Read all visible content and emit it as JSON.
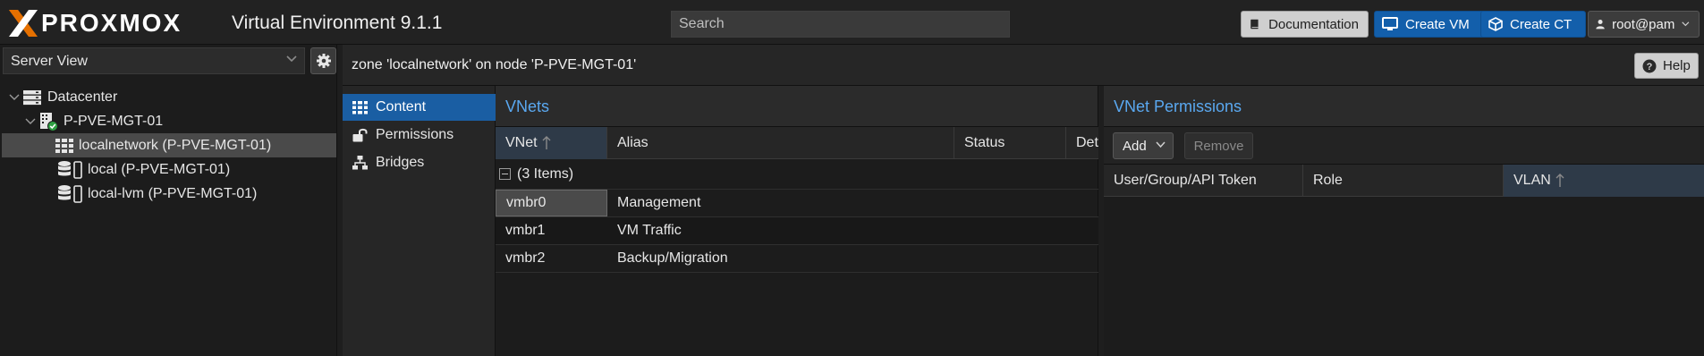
{
  "app": {
    "logo_text": "PROXMOX",
    "product": "Virtual Environment 9.1.1"
  },
  "header": {
    "search_placeholder": "Search",
    "documentation_label": "Documentation",
    "create_vm_label": "Create VM",
    "create_ct_label": "Create CT",
    "user_label": "root@pam"
  },
  "sidebar": {
    "view_select": "Server View",
    "tree": [
      {
        "label": "Datacenter",
        "icon": "datacenter-icon"
      },
      {
        "label": "P-PVE-MGT-01",
        "icon": "node-online-icon"
      },
      {
        "label": "localnetwork (P-PVE-MGT-01)",
        "icon": "sdn-zone-grid-icon",
        "selected": true
      },
      {
        "label": "local (P-PVE-MGT-01)",
        "icon": "storage-icon"
      },
      {
        "label": "local-lvm (P-PVE-MGT-01)",
        "icon": "storage-icon"
      }
    ]
  },
  "main": {
    "title": "zone 'localnetwork' on node 'P-PVE-MGT-01'",
    "help_label": "Help",
    "nav": [
      {
        "label": "Content",
        "icon": "grid-icon",
        "active": true
      },
      {
        "label": "Permissions",
        "icon": "unlock-icon"
      },
      {
        "label": "Bridges",
        "icon": "network-icon"
      }
    ]
  },
  "vnets": {
    "title": "VNets",
    "columns": [
      "VNet",
      "Alias",
      "Status",
      "Det"
    ],
    "sort_column": "VNet",
    "group_label": "(3 Items)",
    "rows": [
      {
        "vnet": "vmbr0",
        "alias": "Management"
      },
      {
        "vnet": "vmbr1",
        "alias": "VM Traffic"
      },
      {
        "vnet": "vmbr2",
        "alias": "Backup/Migration"
      }
    ]
  },
  "permissions": {
    "title": "VNet Permissions",
    "add_label": "Add",
    "remove_label": "Remove",
    "columns": [
      "User/Group/API Token",
      "Role",
      "VLAN"
    ],
    "sort_column": "VLAN"
  },
  "colors": {
    "accent_blue": "#135fab",
    "panel_title_blue": "#5aa8f0",
    "brand_orange": "#e57000",
    "online_green": "#2ea043"
  }
}
